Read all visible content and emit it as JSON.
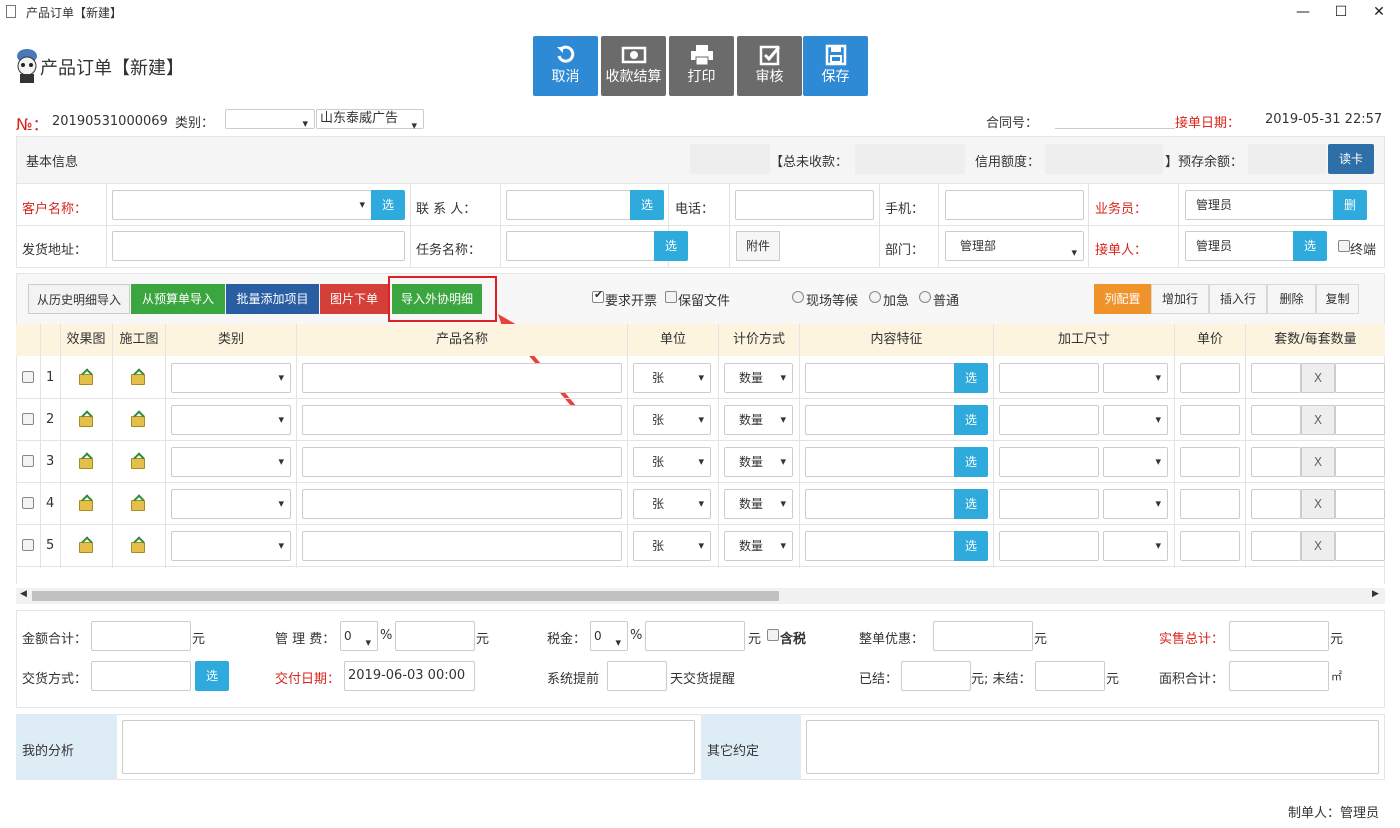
{
  "window": {
    "title": "产品订单【新建】",
    "min": "—",
    "max": "☐",
    "close": "✕"
  },
  "header": {
    "title": "产品订单【新建】"
  },
  "toolbar": [
    {
      "label": "取消",
      "icon": "undo-icon"
    },
    {
      "label": "收款结算",
      "icon": "money-icon"
    },
    {
      "label": "打印",
      "icon": "printer-icon"
    },
    {
      "label": "审核",
      "icon": "check-icon"
    },
    {
      "label": "保存",
      "icon": "save-icon"
    }
  ],
  "order": {
    "no_label": "№：",
    "no": "20190531000069",
    "type_label": "类别：",
    "company": "山东泰威广告",
    "contract_label": "合同号：",
    "date_label": "接单日期：",
    "date": "2019-05-31 22:57"
  },
  "basic": {
    "title": "基本信息",
    "unpaid_label": "【总未收款：",
    "credit_label": "信用额度：",
    "prepay_label": "】预存余额：",
    "read_card": "读卡"
  },
  "form": {
    "customer": "客户名称：",
    "contact": "联 系 人：",
    "phone": "电话：",
    "mobile": "手机：",
    "salesman": "业务员：",
    "salesman_value": "管理员",
    "delete": "删",
    "address": "发货地址：",
    "task": "任务名称：",
    "attach": "附件",
    "dept": "部门：",
    "dept_value": "管理部",
    "receiver": "接单人：",
    "receiver_value": "管理员",
    "end": "终端",
    "select": "选"
  },
  "ops": {
    "import_history": "从历史明细导入",
    "import_budget": "从预算单导入",
    "batch_add": "批量添加项目",
    "image_order": "图片下单",
    "import_outsource": "导入外协明细",
    "need_invoice": "要求开票",
    "keep_file": "保留文件",
    "onsite": "现场等候",
    "urgent": "加急",
    "normal": "普通",
    "col_config": "列配置",
    "add_row": "增加行",
    "insert_row": "插入行",
    "delete": "删除",
    "copy": "复制"
  },
  "table": {
    "headers": [
      "效果图",
      "施工图",
      "类别",
      "产品名称",
      "单位",
      "计价方式",
      "内容特征",
      "加工尺寸",
      "单价",
      "套数/每套数量"
    ],
    "rows": [
      {
        "no": "1",
        "unit": "张",
        "pricing": "数量",
        "sel": "选",
        "x": "X"
      },
      {
        "no": "2",
        "unit": "张",
        "pricing": "数量",
        "sel": "选",
        "x": "X"
      },
      {
        "no": "3",
        "unit": "张",
        "pricing": "数量",
        "sel": "选",
        "x": "X"
      },
      {
        "no": "4",
        "unit": "张",
        "pricing": "数量",
        "sel": "选",
        "x": "X"
      },
      {
        "no": "5",
        "unit": "张",
        "pricing": "数量",
        "sel": "选",
        "x": "X"
      }
    ]
  },
  "totals": {
    "amount": "金额合计：",
    "yuan": "元",
    "mgmt": "管 理 费：",
    "zero": "0",
    "pct": "%",
    "tax": "税金：",
    "incl_tax": "含税",
    "discount": "整单优惠：",
    "actual": "实售总计：",
    "delivery": "交货方式：",
    "deliver_date": "交付日期：",
    "deliver_date_value": "2019-06-03 00:00",
    "sys_ahead": "系统提前",
    "days_remind": "天交货提醒",
    "settled": "已结：",
    "unsettled_yuan": "元; 未结：",
    "area": "面积合计：",
    "sqm": "㎡",
    "select": "选"
  },
  "notes": {
    "analysis": "我的分析",
    "other": "其它约定"
  },
  "footer": {
    "maker": "制单人：管理员"
  }
}
